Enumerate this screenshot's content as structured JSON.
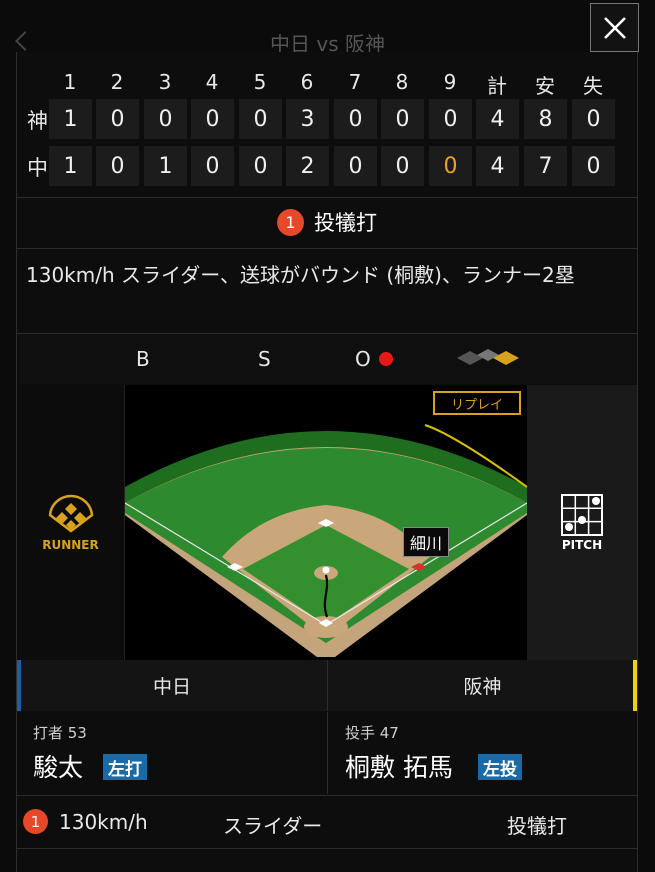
{
  "background": {
    "title": "中日 vs 阪神"
  },
  "close": {
    "icon": "close-icon"
  },
  "scoreboard": {
    "headers": [
      "1",
      "2",
      "3",
      "4",
      "5",
      "6",
      "7",
      "8",
      "9",
      "計",
      "安",
      "失"
    ],
    "rows": [
      {
        "team": "神",
        "cells": [
          "1",
          "0",
          "0",
          "0",
          "0",
          "3",
          "0",
          "0",
          "0",
          "4",
          "8",
          "0"
        ]
      },
      {
        "team": "中",
        "cells": [
          "1",
          "0",
          "1",
          "0",
          "0",
          "2",
          "0",
          "0",
          "0",
          "4",
          "7",
          "0"
        ]
      }
    ],
    "highlight_color": "#f0a020"
  },
  "play": {
    "number": "1",
    "result": "投犠打"
  },
  "description": "130km/h スライダー、送球がバウンド (桐敷)、ランナー2塁",
  "count": {
    "b_label": "B",
    "s_label": "S",
    "o_label": "O",
    "outs": 1,
    "out_color": "#e81818"
  },
  "field": {
    "replay_label": "リプレイ",
    "runner_label": "RUNNER",
    "pitch_label": "PITCH",
    "runner_name": "細川",
    "accent_color": "#d9a21c",
    "grass_color": "#2e8a2e",
    "dirt_color": "#c9a77a"
  },
  "teams": {
    "home": "中日",
    "away": "阪神",
    "home_color": "#1a5fa8",
    "away_color": "#f1d10a"
  },
  "batter": {
    "role": "打者 53",
    "name": "駿太",
    "hand": "左打"
  },
  "pitcher": {
    "role": "投手 47",
    "name": "桐敷 拓馬",
    "hand": "左投"
  },
  "pitch_row": {
    "number": "1",
    "speed": "130km/h",
    "type": "スライダー",
    "result": "投犠打"
  }
}
